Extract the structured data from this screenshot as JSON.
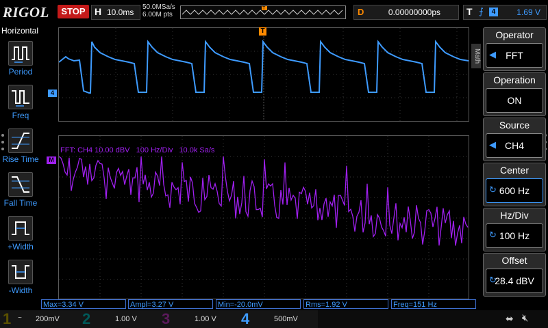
{
  "header": {
    "logo": "RIGOL",
    "run_state": "STOP",
    "timebase_key": "H",
    "timebase_value": "10.0ms",
    "sample_rate": "50.0MSa/s",
    "mem_depth": "6.00M pts",
    "delay_key": "D",
    "delay_value": "0.00000000ps",
    "trigger_key": "T",
    "trigger_channel": "4",
    "trigger_level": "1.69 V"
  },
  "left_menu": {
    "title": "Horizontal",
    "items": [
      {
        "label": "Period",
        "icon": "period-icon"
      },
      {
        "label": "Freq",
        "icon": "freq-icon"
      },
      {
        "label": "Rise Time",
        "icon": "rise-time-icon"
      },
      {
        "label": "Fall Time",
        "icon": "fall-time-icon"
      },
      {
        "label": "+Width",
        "icon": "plus-width-icon"
      },
      {
        "label": "-Width",
        "icon": "minus-width-icon"
      }
    ]
  },
  "waveform": {
    "channel_marker": "4",
    "trigger_marker": "T"
  },
  "fft": {
    "marker": "M",
    "info_label": "FFT:",
    "info_channel": "CH4",
    "info_scale": "10.00 dBV",
    "info_hzdiv": "100 Hz/Div",
    "info_rate": "10.0k Sa/s"
  },
  "right_menu": {
    "math_tab": "Math",
    "items": [
      {
        "title": "Operator",
        "value": "FFT",
        "icon": "left-arrow-icon"
      },
      {
        "title": "Operation",
        "value": "ON",
        "icon": ""
      },
      {
        "title": "Source",
        "value": "CH4",
        "icon": "left-arrow-icon"
      },
      {
        "title": "Center",
        "value": "600 Hz",
        "icon": "knob-icon"
      },
      {
        "title": "Hz/Div",
        "value": "100 Hz",
        "icon": "knob-icon"
      },
      {
        "title": "Offset",
        "value": "28.4 dBV",
        "icon": "knob-icon"
      }
    ]
  },
  "measurements": [
    {
      "text": "Max=3.34 V"
    },
    {
      "text": "Ampl=3.27 V"
    },
    {
      "text": "Min=-20.0mV"
    },
    {
      "text": "Rms=1.92 V"
    },
    {
      "text": "Freq=151 Hz"
    }
  ],
  "channels": [
    {
      "num": "1",
      "coupling": "~",
      "scale": "200mV",
      "color": "#f0d000"
    },
    {
      "num": "2",
      "coupling": "",
      "scale": "1.00 V",
      "color": "#00d8d8"
    },
    {
      "num": "3",
      "coupling": "",
      "scale": "1.00 V",
      "color": "#e04ae0"
    },
    {
      "num": "4",
      "coupling": "",
      "scale": "500mV",
      "color": "#3e9bff"
    }
  ],
  "colors": {
    "ch4": "#3e9bff",
    "math": "#a020f0",
    "stop": "#c41a1a",
    "delay": "#ff8a00"
  }
}
